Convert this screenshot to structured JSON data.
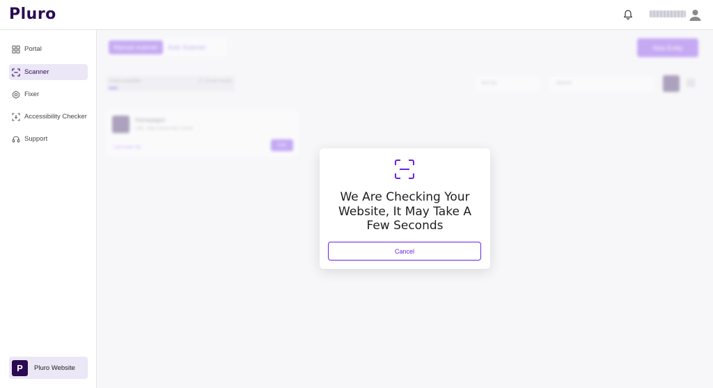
{
  "header": {
    "logo_text": "Pluro",
    "username": "",
    "bell_icon": "bell-icon",
    "user_icon": "user-icon"
  },
  "sidebar": {
    "items": [
      {
        "label": "Portal",
        "icon": "grid-icon",
        "active": false
      },
      {
        "label": "Scanner",
        "icon": "scan-icon",
        "active": true
      },
      {
        "label": "Fixer",
        "icon": "settings-icon",
        "active": false
      },
      {
        "label": "Accessibility Checker",
        "icon": "accessibility-icon",
        "active": false
      },
      {
        "label": "Support",
        "icon": "headset-icon",
        "active": false
      }
    ],
    "site": {
      "badge": "P",
      "label": "Pluro Website"
    }
  },
  "main": {
    "tabs": [
      {
        "label": "Manual scanner",
        "active": true
      },
      {
        "label": "Auto Scanner",
        "active": false
      }
    ],
    "new_entity_label": "New Entity",
    "scans": {
      "label": "Scans available",
      "count": "0 / 10 per month"
    },
    "sort_placeholder": "Sort by",
    "search_placeholder": "Search",
    "card": {
      "title": "Homepage1",
      "url": "URL: https://www.site.com/dr",
      "last_scan": "Last scan: 0d",
      "edit_label": "Edit"
    }
  },
  "modal": {
    "icon": "scan-icon",
    "message": "We Are Checking Your Website, It May Take A Few Seconds",
    "cancel_label": "Cancel"
  },
  "colors": {
    "brand_dark": "#2a0a52",
    "accent": "#6b1fe8",
    "active_nav_bg": "#ebe7f6"
  }
}
